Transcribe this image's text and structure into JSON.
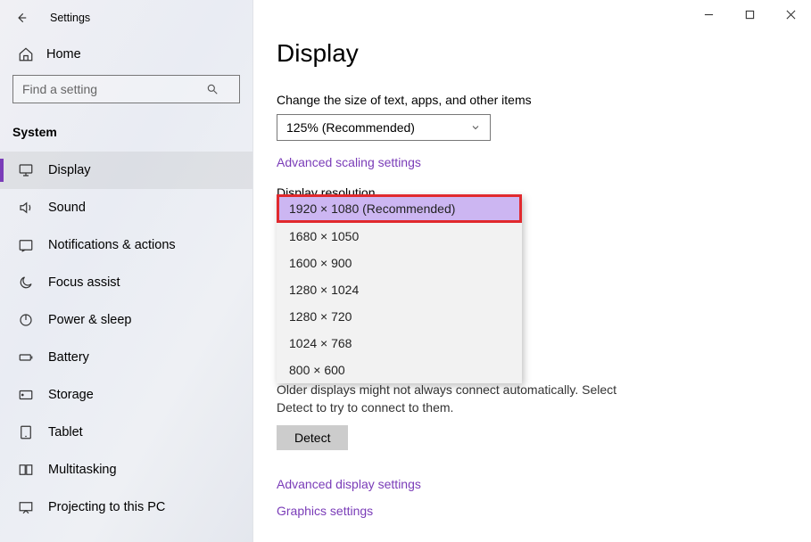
{
  "window": {
    "title": "Settings"
  },
  "home_label": "Home",
  "search": {
    "placeholder": "Find a setting"
  },
  "category_title": "System",
  "nav": [
    {
      "label": "Display"
    },
    {
      "label": "Sound"
    },
    {
      "label": "Notifications & actions"
    },
    {
      "label": "Focus assist"
    },
    {
      "label": "Power & sleep"
    },
    {
      "label": "Battery"
    },
    {
      "label": "Storage"
    },
    {
      "label": "Tablet"
    },
    {
      "label": "Multitasking"
    },
    {
      "label": "Projecting to this PC"
    }
  ],
  "page": {
    "title": "Display",
    "scale_label": "Change the size of text, apps, and other items",
    "scale_value": "125% (Recommended)",
    "adv_scaling_link": "Advanced scaling settings",
    "resolution_label": "Display resolution",
    "resolution_options": [
      "1920 × 1080 (Recommended)",
      "1680 × 1050",
      "1600 × 900",
      "1280 × 1024",
      "1280 × 720",
      "1024 × 768",
      "800 × 600"
    ],
    "older_displays_text": "Older displays might not always connect automatically. Select Detect to try to connect to them.",
    "detect_label": "Detect",
    "adv_display_link": "Advanced display settings",
    "graphics_link": "Graphics settings"
  }
}
